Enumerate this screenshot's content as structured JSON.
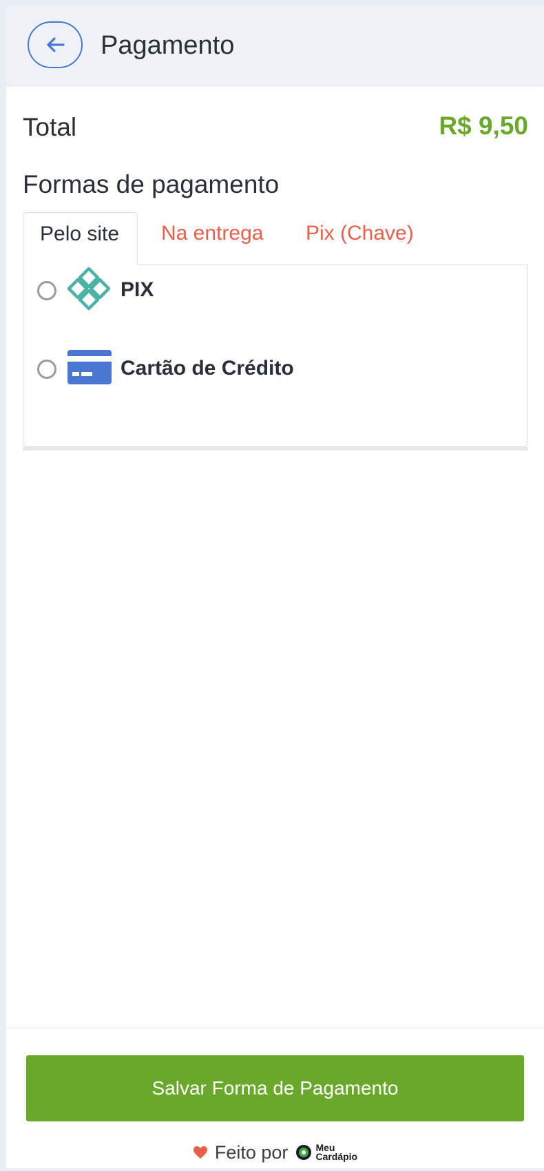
{
  "header": {
    "back_icon": "arrow-left-icon",
    "title": "Pagamento"
  },
  "total": {
    "label": "Total",
    "value": "R$ 9,50",
    "value_color": "#6aa82b"
  },
  "payment": {
    "section_title": "Formas de pagamento",
    "tabs": [
      {
        "label": "Pelo site",
        "active": true
      },
      {
        "label": "Na entrega",
        "active": false
      },
      {
        "label": "Pix (Chave)",
        "active": false
      }
    ],
    "options": [
      {
        "label": "PIX",
        "icon": "pix-icon",
        "selected": false
      },
      {
        "label": "Cartão de Crédito",
        "icon": "credit-card-icon",
        "selected": false
      }
    ]
  },
  "footer": {
    "save_label": "Salvar Forma de Pagamento",
    "made_by": "Feito por",
    "brand_line1": "Meu",
    "brand_line2": "Cardápio",
    "heart_icon": "heart-icon",
    "accent_color": "#6aa82b",
    "tab_inactive_color": "#e8604c"
  }
}
